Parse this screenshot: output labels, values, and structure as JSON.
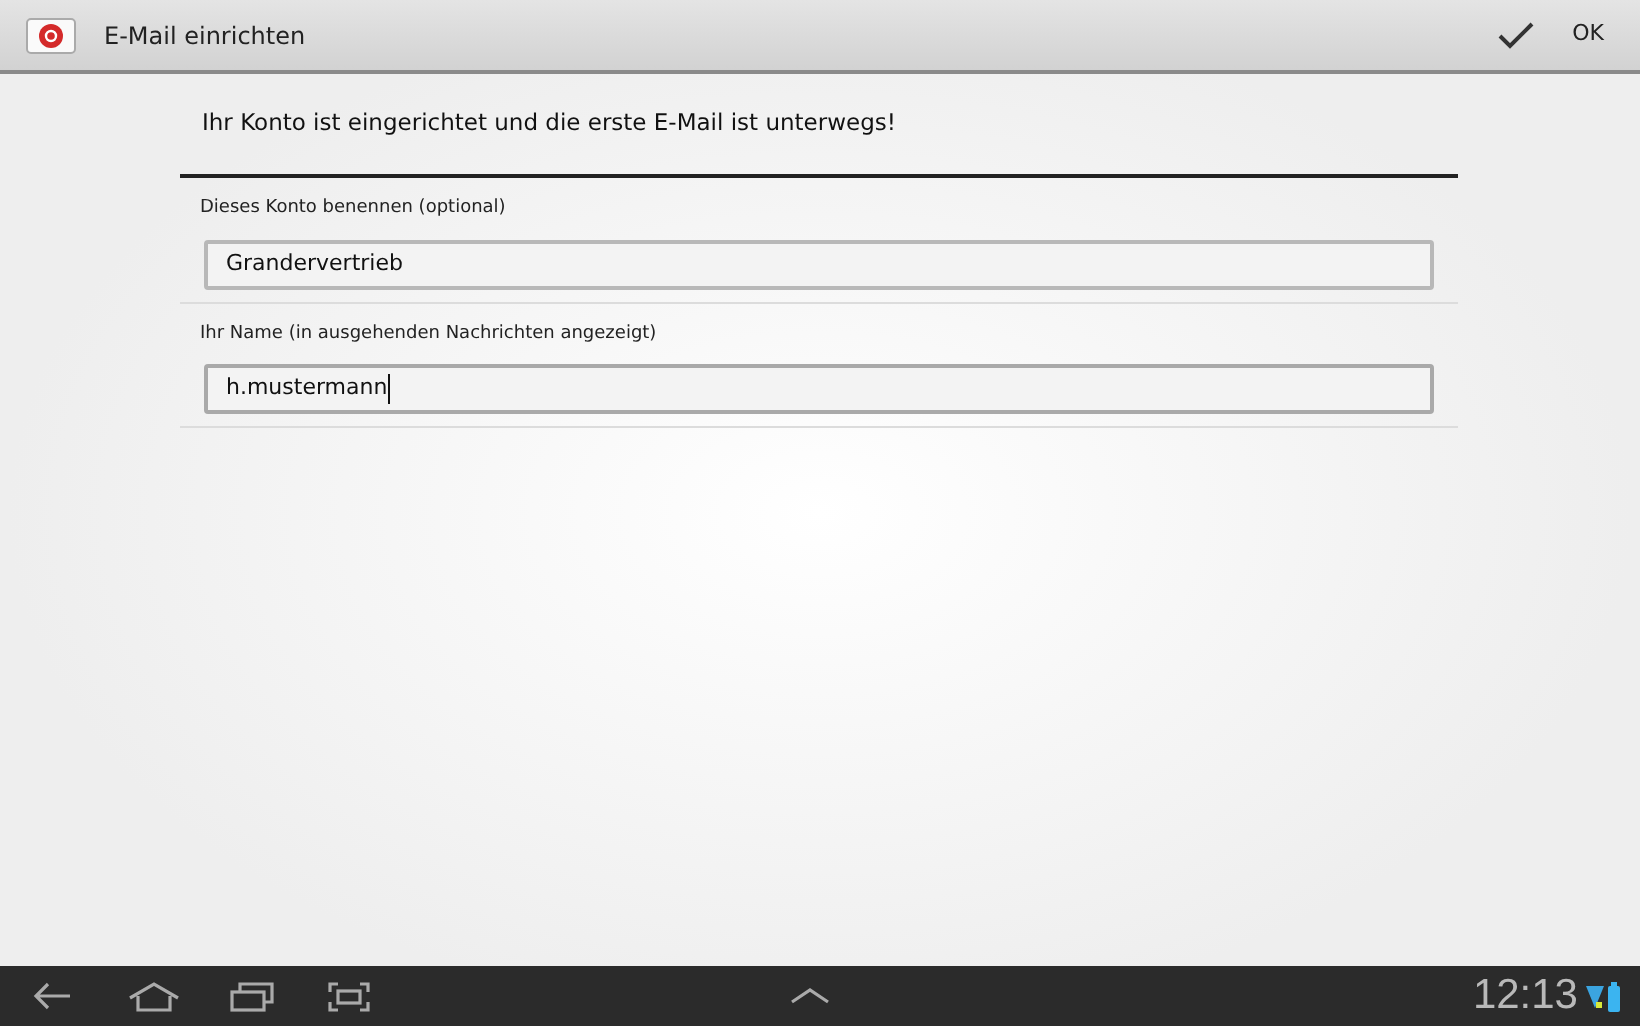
{
  "action_bar": {
    "title": "E-Mail einrichten",
    "done_label": "OK"
  },
  "message": "Ihr Konto ist eingerichtet und die erste E-Mail ist unterwegs!",
  "fields": [
    {
      "label": "Dieses Konto benennen (optional)",
      "value": "Grandervertrieb",
      "focused": false
    },
    {
      "label": "Ihr Name (in ausgehenden Nachrichten angezeigt)",
      "value": "h.mustermann",
      "focused": true
    }
  ],
  "system_bar": {
    "time": "12:13"
  }
}
